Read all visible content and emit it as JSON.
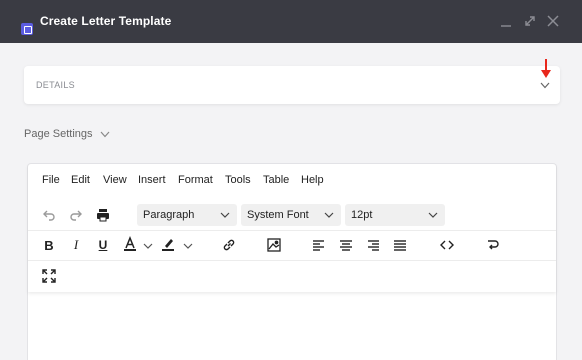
{
  "window": {
    "title": "Create Letter Template",
    "accent_color": "#5b5ce0",
    "titlebar_color": "#3a3b43"
  },
  "details": {
    "label": "DETAILS",
    "annotation_color": "#e8271c"
  },
  "page_settings": {
    "label": "Page Settings"
  },
  "editor": {
    "menu": [
      "File",
      "Edit",
      "View",
      "Insert",
      "Format",
      "Tools",
      "Table",
      "Help"
    ],
    "block_format": "Paragraph",
    "font_family": "System Font",
    "font_size": "12pt",
    "icons": {
      "undo": "undo-icon",
      "redo": "redo-icon",
      "print": "print-icon",
      "bold": "bold-icon",
      "italic": "italic-icon",
      "underline": "underline-icon",
      "text_color": "text-color-icon",
      "highlight": "highlight-icon",
      "link": "link-icon",
      "image": "image-icon",
      "align_left": "align-left-icon",
      "align_center": "align-center-icon",
      "align_right": "align-right-icon",
      "align_justify": "align-justify-icon",
      "source_code": "source-code-icon",
      "rtl": "text-direction-icon",
      "fullscreen": "fullscreen-icon"
    },
    "glyphs": {
      "bold": "B",
      "italic": "I",
      "underline": "U",
      "text_color": "A"
    }
  }
}
